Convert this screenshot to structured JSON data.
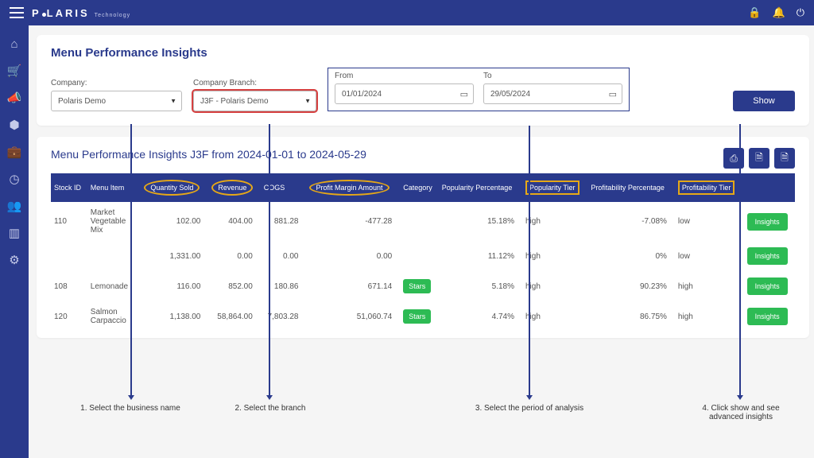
{
  "brand": {
    "name": "POLARIS",
    "tagline": "Technology"
  },
  "page": {
    "title": "Menu Performance Insights"
  },
  "filters": {
    "company_label": "Company:",
    "company_value": "Polaris Demo",
    "branch_label": "Company Branch:",
    "branch_value": "J3F - Polaris Demo",
    "from_label": "From",
    "from_value": "01/01/2024",
    "to_label": "To",
    "to_value": "29/05/2024",
    "show_label": "Show"
  },
  "results": {
    "title": "Menu Performance Insights J3F from 2024-01-01 to 2024-05-29",
    "columns": {
      "stock_id": "Stock ID",
      "menu_item": "Menu Item",
      "qty_sold": "Quantity Sold",
      "revenue": "Revenue",
      "cogs": "COGS",
      "profit_margin": "Profit Margin Amount",
      "category": "Category",
      "pop_pct": "Popularity Percentage",
      "pop_tier": "Popularity Tier",
      "prof_pct": "Profitability Percentage",
      "prof_tier": "Profitability Tier"
    },
    "rows": [
      {
        "stock_id": "110",
        "menu_item": "Market Vegetable Mix",
        "qty": "102.00",
        "rev": "404.00",
        "cogs": "881.28",
        "pm": "-477.28",
        "cat": "",
        "pop_pct": "15.18%",
        "pop_tier": "high",
        "prof_pct": "-7.08%",
        "prof_tier": "low"
      },
      {
        "stock_id": "",
        "menu_item": "",
        "qty": "1,331.00",
        "rev": "0.00",
        "cogs": "0.00",
        "pm": "0.00",
        "cat": "",
        "pop_pct": "11.12%",
        "pop_tier": "high",
        "prof_pct": "0%",
        "prof_tier": "low"
      },
      {
        "stock_id": "108",
        "menu_item": "Lemonade",
        "qty": "116.00",
        "rev": "852.00",
        "cogs": "180.86",
        "pm": "671.14",
        "cat": "Stars",
        "pop_pct": "5.18%",
        "pop_tier": "high",
        "prof_pct": "90.23%",
        "prof_tier": "high"
      },
      {
        "stock_id": "120",
        "menu_item": "Salmon Carpaccio",
        "qty": "1,138.00",
        "rev": "58,864.00",
        "cogs": "7,803.28",
        "pm": "51,060.74",
        "cat": "Stars",
        "pop_pct": "4.74%",
        "pop_tier": "high",
        "prof_pct": "86.75%",
        "prof_tier": "high"
      }
    ],
    "insights_label": "Insights"
  },
  "annotations": {
    "a1": "1. Select the business name",
    "a2": "2. Select the branch",
    "a3": "3. Select the period of analysis",
    "a4": "4. Click show and see advanced insights"
  }
}
